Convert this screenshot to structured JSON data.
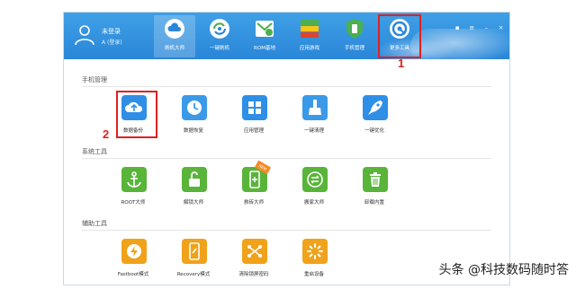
{
  "header": {
    "user_name": "未登录",
    "user_login": "A (登录)"
  },
  "tabs": [
    {
      "label": "刷机大师",
      "icon": "cloud-icon"
    },
    {
      "label": "一键刷机",
      "icon": "refresh-icon"
    },
    {
      "label": "ROM基地",
      "icon": "gift-icon"
    },
    {
      "label": "应用游戏",
      "icon": "apps-icon"
    },
    {
      "label": "手机管理",
      "icon": "phone-shield-icon"
    },
    {
      "label": "更多工具",
      "icon": "settings-icon"
    }
  ],
  "sections": [
    {
      "title": "手机管理",
      "items": [
        {
          "label": "数据备份",
          "icon": "cloud-upload-icon",
          "color": "#2f8fe6"
        },
        {
          "label": "数据恢复",
          "icon": "clock-icon",
          "color": "#3a9ae8"
        },
        {
          "label": "应用管理",
          "icon": "grid-icon",
          "color": "#2f8fe6"
        },
        {
          "label": "一键清理",
          "icon": "broom-icon",
          "color": "#3a9ae8"
        },
        {
          "label": "一键优化",
          "icon": "rocket-icon",
          "color": "#2f8fe6"
        }
      ]
    },
    {
      "title": "系统工具",
      "items": [
        {
          "label": "ROOT大师",
          "icon": "anchor-icon",
          "color": "#59b43a"
        },
        {
          "label": "解锁大师",
          "icon": "unlock-icon",
          "color": "#59b43a"
        },
        {
          "label": "救砖大师",
          "icon": "phone-plus-icon",
          "color": "#59b43a",
          "badge": "NEW"
        },
        {
          "label": "搬家大师",
          "icon": "transfer-icon",
          "color": "#59b43a"
        },
        {
          "label": "卸载内置",
          "icon": "trash-icon",
          "color": "#59b43a"
        }
      ]
    },
    {
      "title": "辅助工具",
      "items": [
        {
          "label": "Fastboot模式",
          "icon": "bolt-icon",
          "color": "#f0a21a"
        },
        {
          "label": "Recovery模式",
          "icon": "phone-recovery-icon",
          "color": "#f0a21a"
        },
        {
          "label": "清除锁屏密码",
          "icon": "shuffle-icon",
          "color": "#f0a21a"
        },
        {
          "label": "重启设备",
          "icon": "spinner-icon",
          "color": "#f0a21a"
        }
      ]
    }
  ],
  "annotations": {
    "marker_1": "1",
    "marker_2": "2"
  },
  "watermark": "头条 @科技数码随时答"
}
